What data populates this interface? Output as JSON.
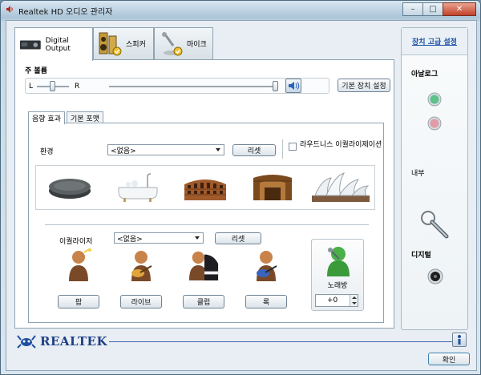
{
  "window": {
    "title": "Realtek HD 오디오 관리자",
    "controls": {
      "minimize": "–",
      "maximize": "□",
      "close": "✕"
    }
  },
  "device_tabs": [
    {
      "label": "Digital Output",
      "icon": "digital-output-device-icon",
      "active": true
    },
    {
      "label": "스피커",
      "icon": "speaker-icon",
      "active": false
    },
    {
      "label": "마이크",
      "icon": "microphone-icon",
      "active": false
    }
  ],
  "volume": {
    "title": "주 볼륨",
    "left_label": "L",
    "right_label": "R",
    "balance": 0.5,
    "level": 1.0,
    "default_device_button": "기본 장치 설정"
  },
  "inner_tabs": [
    {
      "label": "음향 효과",
      "active": true
    },
    {
      "label": "기본 포맷",
      "active": false
    }
  ],
  "environment": {
    "label": "환경",
    "selected": "<없음>",
    "reset_button": "리셋",
    "loudness_label": "라우드니스 이퀄라이제이션",
    "loudness_checked": false,
    "presets": [
      "stone-icon",
      "bathtub-icon",
      "colosseum-icon",
      "opera-house-interior-icon",
      "sydney-opera-house-icon"
    ]
  },
  "equalizer": {
    "label": "이퀄라이저",
    "selected": "<없음>",
    "reset_button": "리셋",
    "presets": [
      {
        "label": "팝",
        "icon": "pop-singer-icon"
      },
      {
        "label": "라이브",
        "icon": "guitarist-icon"
      },
      {
        "label": "클럽",
        "icon": "pianist-icon"
      },
      {
        "label": "록",
        "icon": "rock-guitarist-icon"
      }
    ]
  },
  "karaoke": {
    "label": "노래방",
    "value": "+0",
    "icon": "karaoke-singer-icon"
  },
  "sidebar": {
    "advanced_link": "장치 고급 설정",
    "analog_label": "아날로그",
    "internal_label": "내부",
    "digital_label": "디지털"
  },
  "footer": {
    "brand": "REALTEK",
    "ok_button": "확인",
    "info_icon": "info-icon"
  },
  "colors": {
    "accent_blue": "#1a4fa8",
    "jack_green": "#5cc28a",
    "jack_pink": "#e09aa8"
  }
}
